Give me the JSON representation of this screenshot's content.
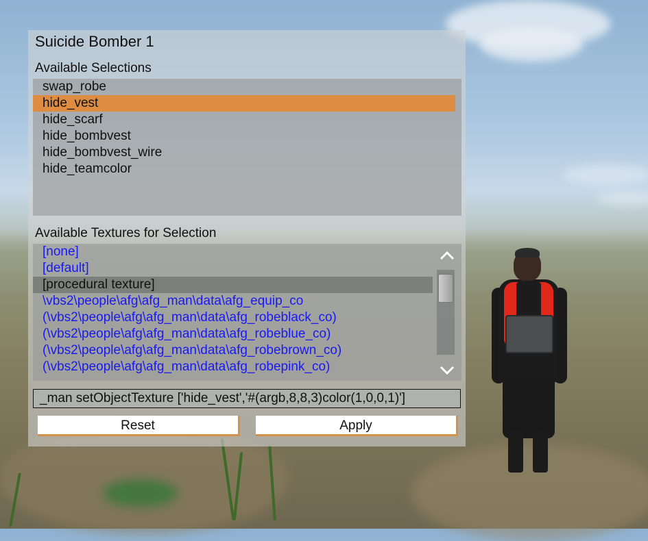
{
  "window": {
    "title": "Suicide Bomber 1"
  },
  "selections": {
    "label": "Available Selections",
    "items": [
      "swap_robe",
      "hide_vest",
      "hide_scarf",
      "hide_bombvest",
      "hide_bombvest_wire",
      "hide_teamcolor"
    ],
    "active_index": 1
  },
  "textures": {
    "label": "Available Textures for Selection",
    "items": [
      "[none]",
      "[default]",
      "[procedural texture]",
      "\\vbs2\\people\\afg\\afg_man\\data\\afg_equip_co",
      "(\\vbs2\\people\\afg\\afg_man\\data\\afg_robeblack_co)",
      "(\\vbs2\\people\\afg\\afg_man\\data\\afg_robeblue_co)",
      "(\\vbs2\\people\\afg\\afg_man\\data\\afg_robebrown_co)",
      "(\\vbs2\\people\\afg\\afg_man\\data\\afg_robepink_co)"
    ],
    "active_index": 2,
    "scroll_position": 0.05
  },
  "command": {
    "value": "_man setObjectTexture ['hide_vest','#(argb,8,8,3)color(1,0,0,1)']"
  },
  "buttons": {
    "reset_label": "Reset",
    "apply_label": "Apply"
  },
  "icons": {
    "scroll_up": "chevron-up-icon",
    "scroll_down": "chevron-down-icon"
  },
  "colors": {
    "selection_highlight": "#dd8c42",
    "texture_link": "#1a1af0",
    "button_accent": "#d4914a"
  }
}
